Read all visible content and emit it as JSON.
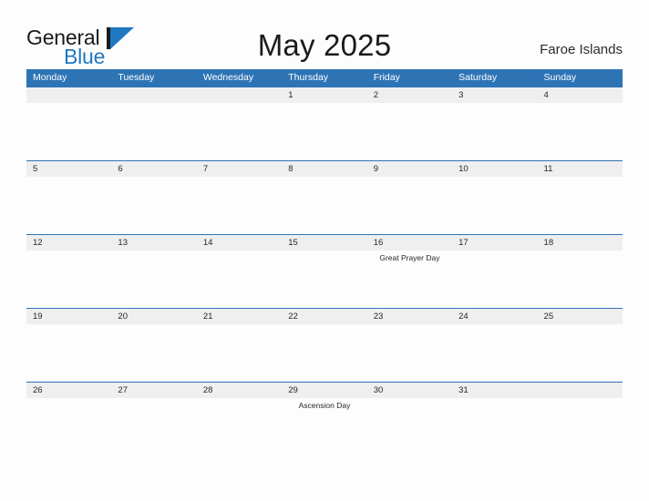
{
  "header": {
    "logo": {
      "text_primary": "General",
      "text_secondary": "Blue",
      "mark": "blue-triangle-logo-mark"
    },
    "title": "May 2025",
    "region": "Faroe Islands"
  },
  "colors": {
    "header_blue": "#2e74b5",
    "date_band_gray": "#efefef",
    "logo_blue": "#1f78c1",
    "page_background": "#fdfdfd",
    "text_dark": "#262626"
  },
  "calendar": {
    "weekdays": [
      "Monday",
      "Tuesday",
      "Wednesday",
      "Thursday",
      "Friday",
      "Saturday",
      "Sunday"
    ],
    "weeks": [
      [
        {
          "date": "",
          "event": ""
        },
        {
          "date": "",
          "event": ""
        },
        {
          "date": "",
          "event": ""
        },
        {
          "date": "1",
          "event": ""
        },
        {
          "date": "2",
          "event": ""
        },
        {
          "date": "3",
          "event": ""
        },
        {
          "date": "4",
          "event": ""
        }
      ],
      [
        {
          "date": "5",
          "event": ""
        },
        {
          "date": "6",
          "event": ""
        },
        {
          "date": "7",
          "event": ""
        },
        {
          "date": "8",
          "event": ""
        },
        {
          "date": "9",
          "event": ""
        },
        {
          "date": "10",
          "event": ""
        },
        {
          "date": "11",
          "event": ""
        }
      ],
      [
        {
          "date": "12",
          "event": ""
        },
        {
          "date": "13",
          "event": ""
        },
        {
          "date": "14",
          "event": ""
        },
        {
          "date": "15",
          "event": ""
        },
        {
          "date": "16",
          "event": "Great Prayer Day"
        },
        {
          "date": "17",
          "event": ""
        },
        {
          "date": "18",
          "event": ""
        }
      ],
      [
        {
          "date": "19",
          "event": ""
        },
        {
          "date": "20",
          "event": ""
        },
        {
          "date": "21",
          "event": ""
        },
        {
          "date": "22",
          "event": ""
        },
        {
          "date": "23",
          "event": ""
        },
        {
          "date": "24",
          "event": ""
        },
        {
          "date": "25",
          "event": ""
        }
      ],
      [
        {
          "date": "26",
          "event": ""
        },
        {
          "date": "27",
          "event": ""
        },
        {
          "date": "28",
          "event": ""
        },
        {
          "date": "29",
          "event": "Ascension Day"
        },
        {
          "date": "30",
          "event": ""
        },
        {
          "date": "31",
          "event": ""
        },
        {
          "date": "",
          "event": ""
        }
      ]
    ]
  }
}
